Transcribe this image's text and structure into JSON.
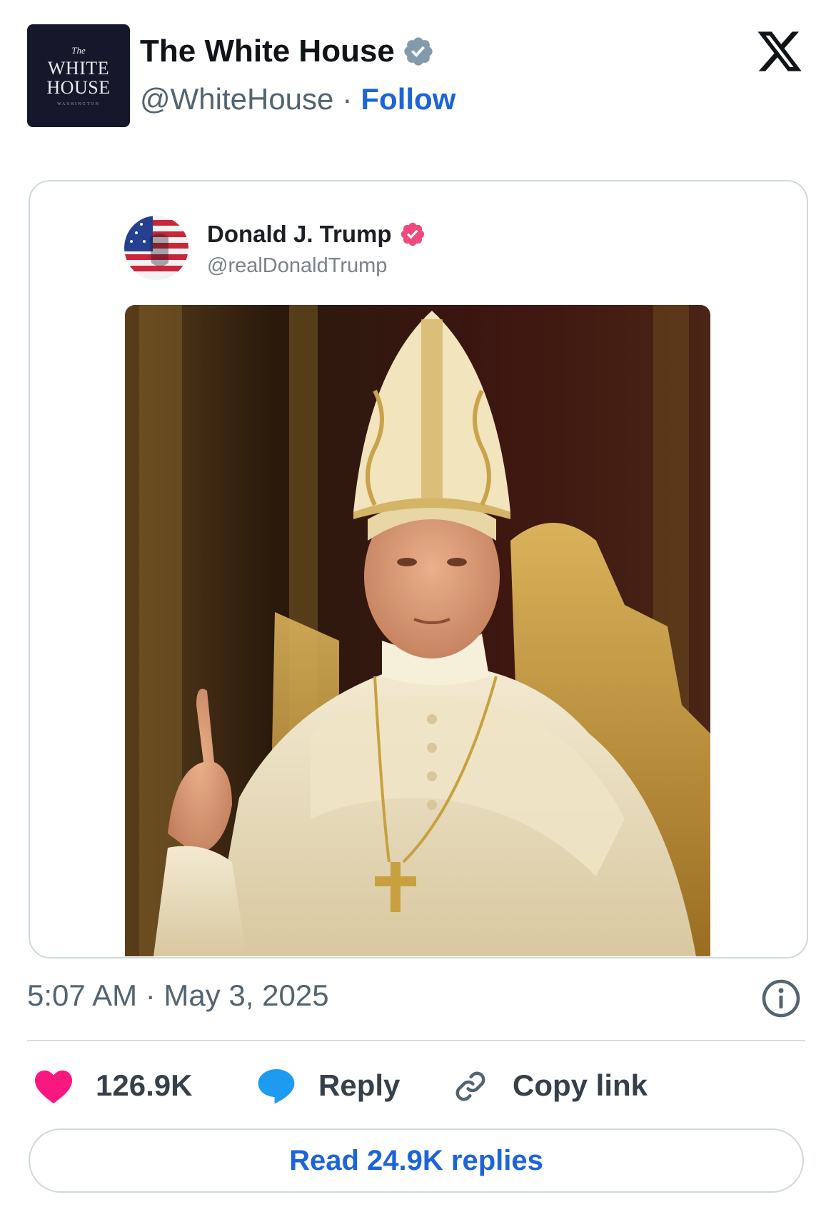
{
  "header": {
    "account_name": "The White House",
    "handle": "@WhiteHouse",
    "separator": "·",
    "follow_label": "Follow",
    "logo_lines": [
      "The",
      "WHITE",
      "HOUSE",
      "WASHINGTON"
    ],
    "verified_badge_color": "#829aab",
    "icons": {
      "badge": "verified-badge-icon",
      "brand": "x-logo-icon"
    }
  },
  "embedded_post": {
    "author_name": "Donald J. Trump",
    "author_handle": "@realDonaldTrump",
    "verified_badge_color": "#f0497c",
    "image_alt": "Painting-style image of a man in papal vestments and mitre seated on a gilded throne, raising one finger"
  },
  "meta": {
    "timestamp": "5:07 AM · May 3, 2025",
    "icons": {
      "info": "info-icon"
    }
  },
  "actions": {
    "likes_count": "126.9K",
    "reply_label": "Reply",
    "copy_link_label": "Copy link",
    "heart_color": "#f91880",
    "reply_color": "#1d9bf0",
    "icons": [
      "heart-icon",
      "reply-bubble-icon",
      "link-icon"
    ]
  },
  "read_replies_label": "Read 24.9K replies"
}
